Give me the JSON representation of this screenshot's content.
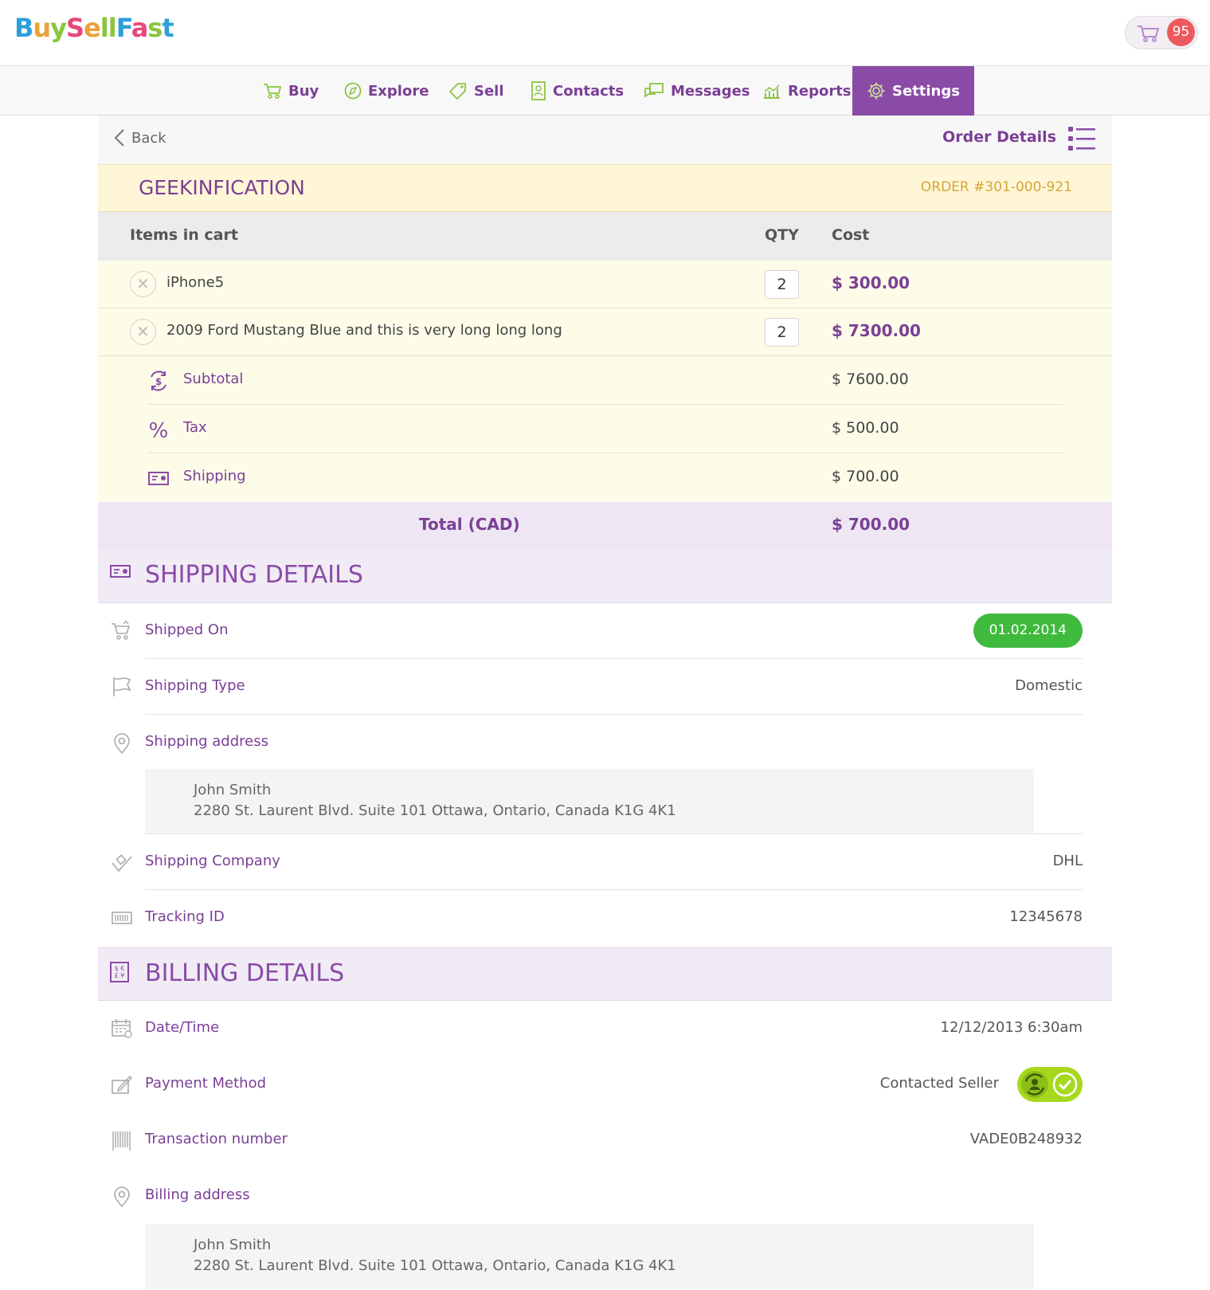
{
  "header": {
    "logo": [
      "Buy",
      "Sell",
      "Fast"
    ],
    "cart_count": "95"
  },
  "nav": {
    "items": [
      {
        "label": "Buy",
        "icon": "cart-icon"
      },
      {
        "label": "Explore",
        "icon": "compass-icon"
      },
      {
        "label": "Sell",
        "icon": "tag-icon"
      },
      {
        "label": "Contacts",
        "icon": "contacts-book-icon"
      },
      {
        "label": "Messages",
        "icon": "chat-bubbles-icon"
      },
      {
        "label": "Reports",
        "icon": "bar-chart-icon"
      },
      {
        "label": "Settings",
        "icon": "gear-icon"
      }
    ],
    "active": "Settings"
  },
  "subheader": {
    "back_label": "Back",
    "page_title": "Order Details"
  },
  "shop": {
    "name": "GEEKINFICATION",
    "order_number": "ORDER #301-000-921"
  },
  "cart_table": {
    "columns": [
      "Items in cart",
      "QTY",
      "Cost"
    ],
    "rows": [
      {
        "item": "iPhone5",
        "qty": "2",
        "cost": "$ 300.00"
      },
      {
        "item": "2009 Ford Mustang Blue and this is very long long long",
        "qty": "2",
        "cost": "$ 7300.00"
      }
    ],
    "summary": [
      {
        "label": "Subtotal",
        "value": "$ 7600.00",
        "icon": "dollar-cycle-icon"
      },
      {
        "label": "Tax",
        "value": "$ 500.00",
        "icon": "percent-icon"
      },
      {
        "label": "Shipping",
        "value": "$ 700.00",
        "icon": "shipping-card-icon"
      }
    ],
    "total_label": "Total (CAD)",
    "total_value": "$ 700.00"
  },
  "shipping": {
    "title": "SHIPPING DETAILS",
    "shipped_on_label": "Shipped On",
    "shipped_on_value": "01.02.2014",
    "type_label": "Shipping Type",
    "type_value": "Domestic",
    "address_label": "Shipping address",
    "address_name": "John Smith",
    "address_line": "2280 St. Laurent Blvd. Suite 101 Ottawa, Ontario, Canada K1G 4K1",
    "company_label": "Shipping Company",
    "company_value": "DHL",
    "tracking_label": "Tracking ID",
    "tracking_value": "12345678"
  },
  "billing": {
    "title": "BILLING DETAILS",
    "datetime_label": "Date/Time",
    "datetime_value": "12/12/2013 6:30am",
    "payment_label": "Payment Method",
    "payment_value": "Contacted Seller",
    "transaction_label": "Transaction number",
    "transaction_value": "VADE0B248932",
    "address_label": "Billing address",
    "address_name": "John Smith",
    "address_line": "2280 St. Laurent Blvd. Suite 101 Ottawa, Ontario, Canada K1G 4K1"
  },
  "colors": {
    "brand_purple": "#7b3f96",
    "active_nav": "#8a4ba6",
    "badge_red": "#ec5a5e",
    "shipped_green": "#3fba3d",
    "toggle_lime": "#a7d81d",
    "shop_yellow": "#fef6d6"
  }
}
